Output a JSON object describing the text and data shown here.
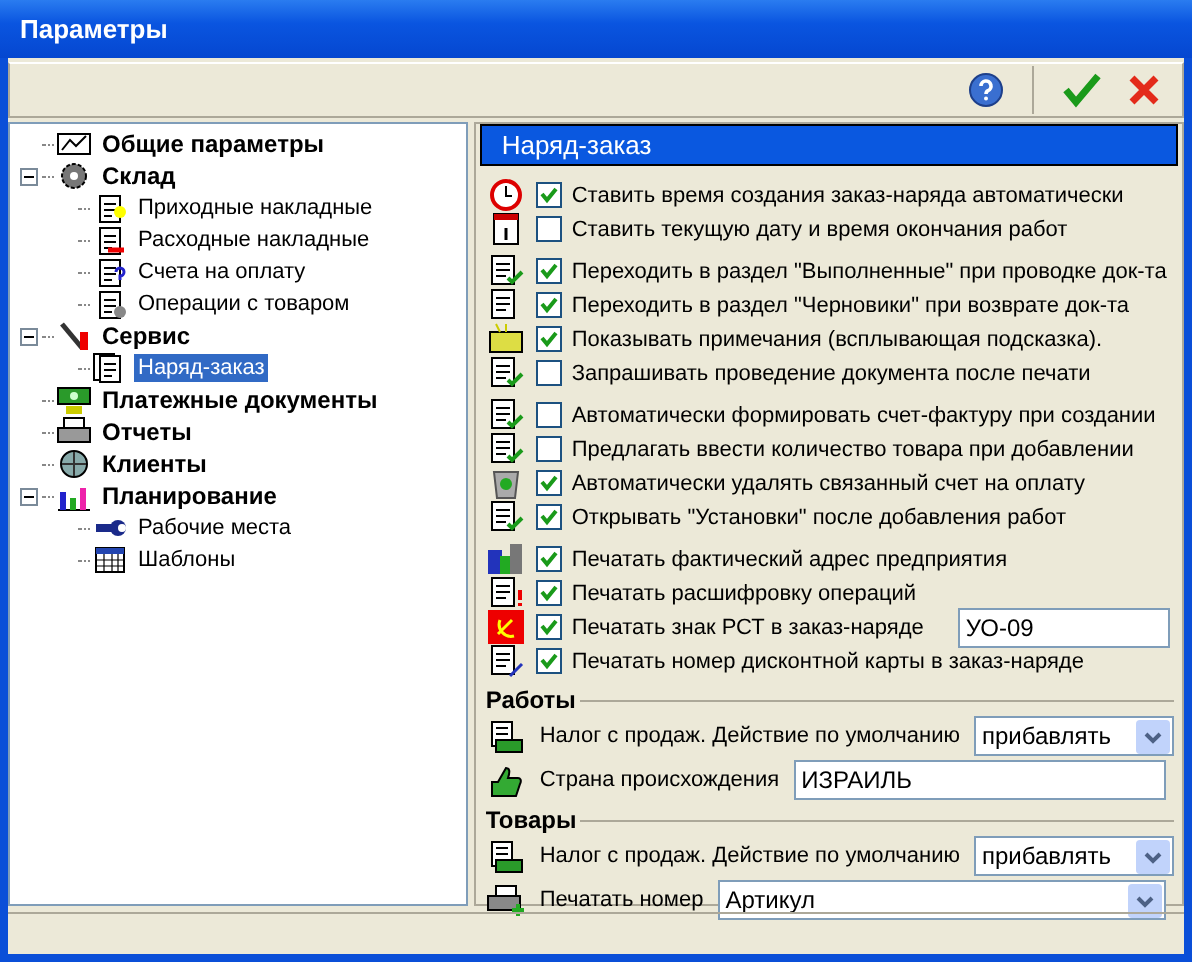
{
  "window": {
    "title": "Параметры"
  },
  "tree": [
    {
      "label": "Общие параметры",
      "selected": false
    },
    {
      "label": "Склад",
      "selected": false,
      "expanded": true,
      "children": [
        {
          "label": "Приходные накладные",
          "selected": false
        },
        {
          "label": "Расходные накладные",
          "selected": false
        },
        {
          "label": "Счета на оплату",
          "selected": false
        },
        {
          "label": "Операции с товаром",
          "selected": false
        }
      ]
    },
    {
      "label": "Сервис",
      "selected": false,
      "expanded": true,
      "children": [
        {
          "label": "Наряд-заказ",
          "selected": true
        }
      ]
    },
    {
      "label": "Платежные документы",
      "selected": false
    },
    {
      "label": "Отчеты",
      "selected": false
    },
    {
      "label": "Клиенты",
      "selected": false
    },
    {
      "label": "Планирование",
      "selected": false,
      "expanded": true,
      "children": [
        {
          "label": "Рабочие места",
          "selected": false
        },
        {
          "label": "Шаблоны",
          "selected": false
        }
      ]
    }
  ],
  "panel": {
    "title": "Наряд-заказ",
    "option_groups": [
      [
        {
          "label": "Ставить время создания заказ-наряда автоматически",
          "checked": true
        },
        {
          "label": "Ставить текущую  дату  и время окончания работ",
          "checked": false
        }
      ],
      [
        {
          "label": "Переходить в раздел \"Выполненные\" при проводке док-та",
          "checked": true
        },
        {
          "label": "Переходить в раздел \"Черновики\" при возврате док-та",
          "checked": true
        },
        {
          "label": "Показывать примечания (всплывающая подсказка).",
          "checked": true
        },
        {
          "label": "Запрашивать проведение документа после печати",
          "checked": false
        }
      ],
      [
        {
          "label": "Автоматически формировать счет-фактуру при создании",
          "checked": false
        },
        {
          "label": "Предлагать ввести количество товара при добавлении",
          "checked": false
        },
        {
          "label": "Автоматически удалять связанный счет на оплату",
          "checked": true
        },
        {
          "label": "Открывать \"Установки\" после добавления работ",
          "checked": true
        }
      ],
      [
        {
          "label": "Печатать фактический адрес предприятия",
          "checked": true
        },
        {
          "label": "Печатать расшифровку операций",
          "checked": true
        },
        {
          "label": "Печатать знак РСТ в заказ-наряде",
          "checked": true,
          "value": "УО-09"
        },
        {
          "label": "Печатать номер дисконтной карты в заказ-наряде",
          "checked": true
        }
      ]
    ],
    "sections": [
      {
        "title": "Работы",
        "fields": [
          {
            "kind": "dropdown",
            "label": "Налог с продаж. Действие по умолчанию",
            "value": "прибавлять"
          },
          {
            "kind": "text",
            "label": "Страна происхождения",
            "value": "ИЗРАИЛЬ"
          }
        ]
      },
      {
        "title": "Товары",
        "fields": [
          {
            "kind": "dropdown",
            "label": "Налог с продаж. Действие по умолчанию",
            "value": "прибавлять"
          },
          {
            "kind": "dropdown",
            "label": "Печатать номер",
            "value": "Артикул"
          }
        ]
      }
    ]
  }
}
